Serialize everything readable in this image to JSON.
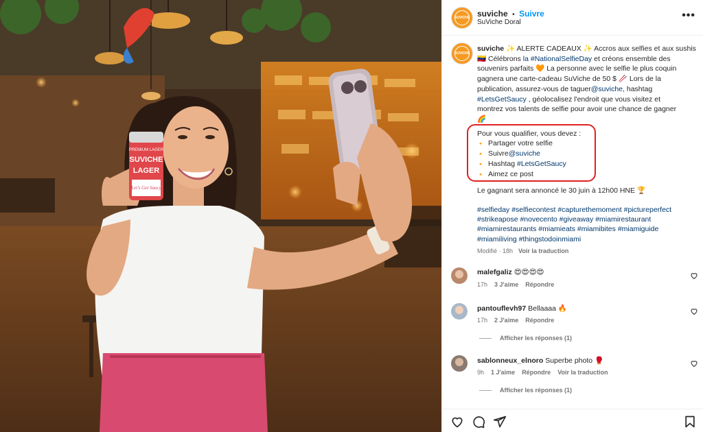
{
  "header": {
    "username": "suviche",
    "separator": "•",
    "follow_label": "Suivre",
    "location": "SuViche Doral",
    "avatar_text": "SUVICHE",
    "more_icon": "more-dots-icon"
  },
  "caption": {
    "username": "suviche",
    "line1": "✨ ALERTE CADEAUX ✨ Accros aux selfies et aux sushis",
    "line2a": "🇻🇪 Célébrons ",
    "line2link": "la #NationalSelfieDay",
    "line2b": " et créons ensemble des",
    "line3": "souvenirs parfaits 🧡 La personne avec le selfie le plus coquin",
    "line4": "gagnera une carte-cadeau SuViche de 50 $ 🥢 Lors de la",
    "line5a": "publication, assurez-vous de taguer",
    "line5link": "@suviche",
    "line5b": ", hashtag",
    "line6link": "#LetsGetSaucy",
    "line6b": " , géolocalisez l'endroit que vous visitez et",
    "line7": "montrez vos talents de selfie pour avoir une chance de gagner",
    "line8": "🌈"
  },
  "qualify": {
    "intro": "Pour vous qualifier, vous devez :",
    "bullet": "🔸",
    "items": [
      {
        "text": "Partager votre selfie",
        "link": ""
      },
      {
        "text": "Suivre",
        "link": "@suviche"
      },
      {
        "text": "Hashtag ",
        "link": "#LetsGetSaucy"
      },
      {
        "text": "Aimez ce post",
        "link": ""
      }
    ]
  },
  "winner": "Le gagnant sera annoncé le 30 juin à 12h00 HNE 🏆",
  "hashtags": [
    "#selfieday #selfiecontest #capturethemoment #pictureperfect",
    "#strikeapose #novecento #giveaway #miamirestaurant",
    "#miamirestaurants #miamieats #miamibites #miamiguide",
    "#miamiliving #thingstodoinmiami"
  ],
  "post_meta": {
    "modified": "Modifié · 18h",
    "translate": "Voir la traduction"
  },
  "comments": [
    {
      "user": "malefgaliz",
      "text": "😍😍😍😍",
      "time": "17h",
      "likes": "3 J'aime",
      "reply": "Répondre",
      "translate": "",
      "replies": ""
    },
    {
      "user": "pantouflevh97",
      "text": "Bellaaaa 🔥",
      "time": "17h",
      "likes": "2 J'aime",
      "reply": "Répondre",
      "translate": "",
      "replies": "Afficher les réponses (1)"
    },
    {
      "user": "sablonneux_elnoro",
      "text": "Superbe photo 🥊",
      "time": "9h",
      "likes": "1 J'aime",
      "reply": "Répondre",
      "translate": "Voir la traduction",
      "replies": "Afficher les réponses (1)"
    }
  ],
  "actions": {
    "like_icon": "heart-icon",
    "comment_icon": "comment-icon",
    "share_icon": "share-icon",
    "save_icon": "bookmark-icon"
  },
  "can": {
    "brand": "SUVICHE",
    "sub": "LAGER",
    "tag": "PREMIUM LAGER",
    "script": "Let's Get Saucy"
  },
  "colors": {
    "brand_orange": "#f59a23",
    "link_blue": "#00376b",
    "follow_blue": "#0095f6",
    "highlight_red": "#e02020",
    "shirt_pink": "#d94a70"
  }
}
